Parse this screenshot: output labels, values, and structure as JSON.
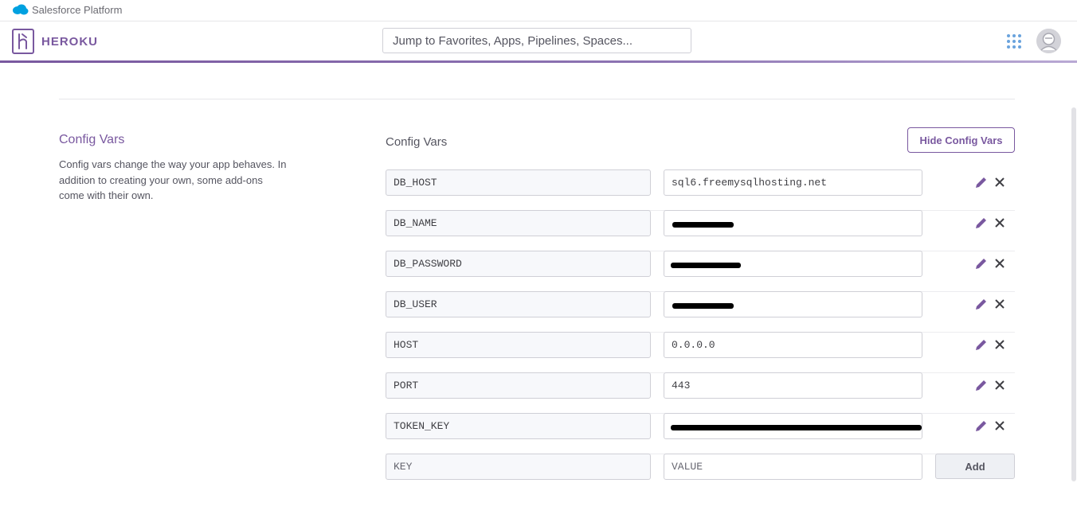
{
  "salesforce_bar": {
    "brand": "Salesforce Platform"
  },
  "header": {
    "logo_text": "HEROKU",
    "search_placeholder": "Jump to Favorites, Apps, Pipelines, Spaces..."
  },
  "config_section": {
    "title": "Config Vars",
    "description": "Config vars change the way your app behaves. In addition to creating your own, some add-ons come with their own.",
    "table_title": "Config Vars",
    "hide_button": "Hide Config Vars",
    "vars": [
      {
        "key": "DB_HOST",
        "value": "sql6.freemysqlhosting.net",
        "redacted": false
      },
      {
        "key": "DB_NAME",
        "value": "",
        "redacted": true
      },
      {
        "key": "DB_PASSWORD",
        "value": "",
        "redacted": true
      },
      {
        "key": "DB_USER",
        "value": "",
        "redacted": true
      },
      {
        "key": "HOST",
        "value": "0.0.0.0",
        "redacted": false
      },
      {
        "key": "PORT",
        "value": "443",
        "redacted": false
      },
      {
        "key": "TOKEN_KEY",
        "value": "",
        "redacted": true
      }
    ],
    "new_var": {
      "key_placeholder": "KEY",
      "value_placeholder": "VALUE",
      "add_button": "Add"
    }
  },
  "icons": [
    "salesforce-cloud-icon",
    "heroku-logo-icon",
    "apps-grid-icon",
    "avatar-icon",
    "edit-pencil-icon",
    "delete-x-icon"
  ],
  "colors": {
    "accent": "#79589f",
    "apps_dots": "#6aa3dd",
    "salesforce_blue": "#00a1e0"
  }
}
